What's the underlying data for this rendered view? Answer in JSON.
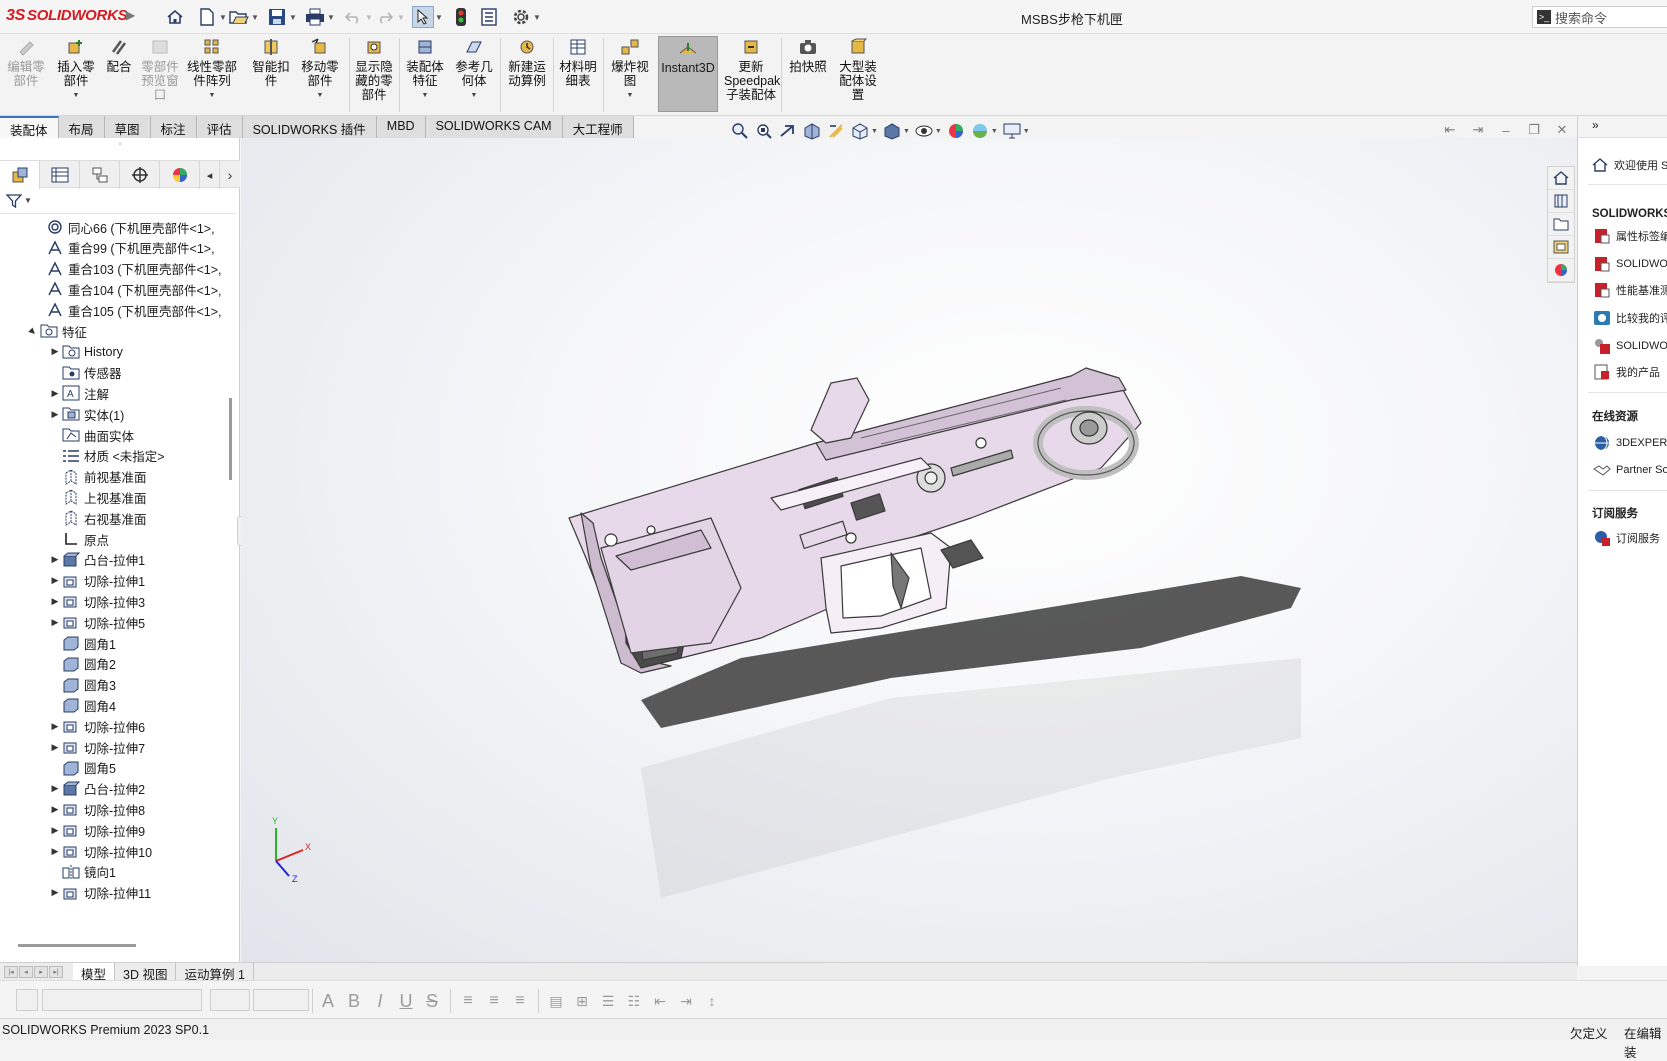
{
  "app": {
    "brand": "SOLIDWORKS",
    "document_title": "MSBS步枪下机匣"
  },
  "search": {
    "label": "搜索命令"
  },
  "colors": {
    "brand_red": "#d71920",
    "accent_blue": "#3b74c4",
    "model_fill": "#e8d9ea",
    "model_edge": "#3a3a3a"
  },
  "ribbon": {
    "buttons": [
      {
        "label": "编辑零部件",
        "icon": "edit-component-icon",
        "disabled": true
      },
      {
        "label": "插入零部件",
        "icon": "insert-component-icon"
      },
      {
        "label": "配合",
        "icon": "mate-icon"
      },
      {
        "label": "零部件预览窗口",
        "icon": "component-preview-icon",
        "disabled": true
      },
      {
        "label": "线性零部件阵列",
        "icon": "linear-pattern-icon"
      },
      {
        "label": "智能扣件",
        "icon": "smart-fastener-icon"
      },
      {
        "label": "移动零部件",
        "icon": "move-component-icon"
      },
      {
        "label": "显示隐藏的零部件",
        "icon": "show-hidden-icon"
      },
      {
        "label": "装配体特征",
        "icon": "assembly-feature-icon"
      },
      {
        "label": "参考几何体",
        "icon": "reference-geometry-icon"
      },
      {
        "label": "新建运动算例",
        "icon": "motion-study-icon"
      },
      {
        "label": "材料明细表",
        "icon": "bom-icon"
      },
      {
        "label": "爆炸视图",
        "icon": "exploded-view-icon"
      },
      {
        "label": "Instant3D",
        "icon": "instant3d-icon"
      },
      {
        "label": "更新Speedpak子装配体",
        "icon": "speedpak-icon"
      },
      {
        "label": "拍快照",
        "icon": "snapshot-icon"
      },
      {
        "label": "大型装配体设置",
        "icon": "large-assembly-icon"
      }
    ]
  },
  "command_tabs": [
    "装配体",
    "布局",
    "草图",
    "标注",
    "评估",
    "SOLIDWORKS 插件",
    "MBD",
    "SOLIDWORKS CAM",
    "大工程师"
  ],
  "feature_tree": {
    "items": [
      {
        "label": "同心66 (下机匣壳部件<1>,",
        "icon": "concentric-mate-icon",
        "indent": 0,
        "arrow": ""
      },
      {
        "label": "重合99 (下机匣壳部件<1>,",
        "icon": "coincident-mate-icon",
        "indent": 0,
        "arrow": ""
      },
      {
        "label": "重合103 (下机匣壳部件<1>,",
        "icon": "coincident-mate-icon",
        "indent": 0,
        "arrow": ""
      },
      {
        "label": "重合104 (下机匣壳部件<1>,",
        "icon": "coincident-mate-icon",
        "indent": 0,
        "arrow": ""
      },
      {
        "label": "重合105 (下机匣壳部件<1>,",
        "icon": "coincident-mate-icon",
        "indent": 0,
        "arrow": ""
      },
      {
        "label": "特征",
        "icon": "features-folder-icon",
        "indent": -1,
        "arrow": "down"
      },
      {
        "label": "History",
        "icon": "history-icon",
        "indent": 1,
        "arrow": "right"
      },
      {
        "label": "传感器",
        "icon": "sensor-icon",
        "indent": 1,
        "arrow": ""
      },
      {
        "label": "注解",
        "icon": "annotation-icon",
        "indent": 1,
        "arrow": "right"
      },
      {
        "label": "实体(1)",
        "icon": "solid-body-icon",
        "indent": 1,
        "arrow": "right"
      },
      {
        "label": "曲面实体",
        "icon": "surface-body-icon",
        "indent": 1,
        "arrow": ""
      },
      {
        "label": "材质 <未指定>",
        "icon": "material-icon",
        "indent": 1,
        "arrow": ""
      },
      {
        "label": "前视基准面",
        "icon": "plane-icon",
        "indent": 1,
        "arrow": ""
      },
      {
        "label": "上视基准面",
        "icon": "plane-icon",
        "indent": 1,
        "arrow": ""
      },
      {
        "label": "右视基准面",
        "icon": "plane-icon",
        "indent": 1,
        "arrow": ""
      },
      {
        "label": "原点",
        "icon": "origin-icon",
        "indent": 1,
        "arrow": ""
      },
      {
        "label": "凸台-拉伸1",
        "icon": "boss-extrude-icon",
        "indent": 1,
        "arrow": "right"
      },
      {
        "label": "切除-拉伸1",
        "icon": "cut-extrude-icon",
        "indent": 1,
        "arrow": "right"
      },
      {
        "label": "切除-拉伸3",
        "icon": "cut-extrude-icon",
        "indent": 1,
        "arrow": "right"
      },
      {
        "label": "切除-拉伸5",
        "icon": "cut-extrude-icon",
        "indent": 1,
        "arrow": "right"
      },
      {
        "label": "圆角1",
        "icon": "fillet-icon",
        "indent": 1,
        "arrow": ""
      },
      {
        "label": "圆角2",
        "icon": "fillet-icon",
        "indent": 1,
        "arrow": ""
      },
      {
        "label": "圆角3",
        "icon": "fillet-icon",
        "indent": 1,
        "arrow": ""
      },
      {
        "label": "圆角4",
        "icon": "fillet-icon",
        "indent": 1,
        "arrow": ""
      },
      {
        "label": "切除-拉伸6",
        "icon": "cut-extrude-icon",
        "indent": 1,
        "arrow": "right"
      },
      {
        "label": "切除-拉伸7",
        "icon": "cut-extrude-icon",
        "indent": 1,
        "arrow": "right"
      },
      {
        "label": "圆角5",
        "icon": "fillet-icon",
        "indent": 1,
        "arrow": ""
      },
      {
        "label": "凸台-拉伸2",
        "icon": "boss-extrude-icon",
        "indent": 1,
        "arrow": "right"
      },
      {
        "label": "切除-拉伸8",
        "icon": "cut-extrude-icon",
        "indent": 1,
        "arrow": "right"
      },
      {
        "label": "切除-拉伸9",
        "icon": "cut-extrude-icon",
        "indent": 1,
        "arrow": "right"
      },
      {
        "label": "切除-拉伸10",
        "icon": "cut-extrude-icon",
        "indent": 1,
        "arrow": "right"
      },
      {
        "label": "镜向1",
        "icon": "mirror-icon",
        "indent": 1,
        "arrow": ""
      },
      {
        "label": "切除-拉伸11",
        "icon": "cut-extrude-icon",
        "indent": 1,
        "arrow": "right"
      }
    ]
  },
  "triad": {
    "x": "X",
    "y": "Y",
    "z": "Z"
  },
  "task_pane": {
    "header": "欢迎使用 S",
    "section_solidworks": "SOLIDWORKS ",
    "items_sw": [
      "属性标签编",
      "SOLIDWO",
      "性能基准测",
      "比较我的评",
      "SOLIDWO",
      "我的产品"
    ],
    "section_online": "在线资源",
    "items_online": [
      "3DEXPERIE",
      "Partner So"
    ],
    "section_sub": "订阅服务",
    "items_sub": [
      "订阅服务"
    ]
  },
  "bottom_tabs": [
    "模型",
    "3D 视图",
    "运动算例 1"
  ],
  "status": {
    "version": "SOLIDWORKS Premium 2023 SP0.1",
    "state1": "欠定义",
    "state2": "在编辑 装"
  }
}
